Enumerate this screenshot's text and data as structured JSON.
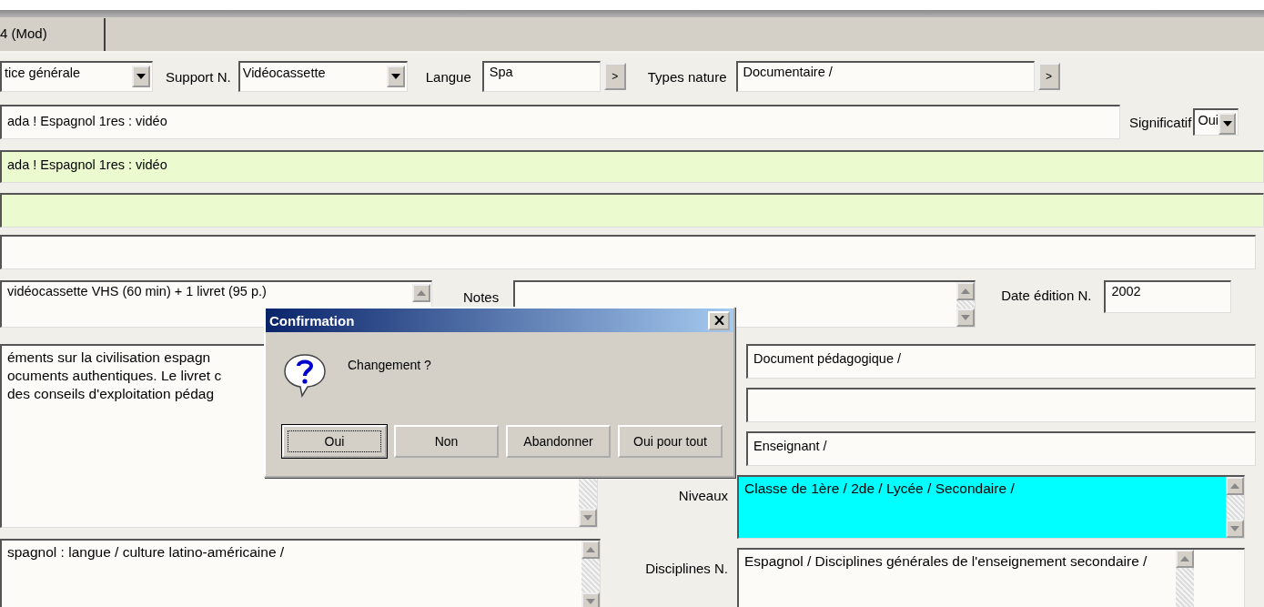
{
  "tab": {
    "label": "4 (Mod)",
    "selected": true
  },
  "notice_type": {
    "value": "tice générale"
  },
  "support": {
    "label": "Support N.",
    "value": "Vidéocassette"
  },
  "langue": {
    "label": "Langue",
    "value": "Spa",
    "button": ">"
  },
  "types_nature": {
    "label": "Types nature",
    "value": "Documentaire /",
    "button": ">"
  },
  "title_field": {
    "value": "ada ! Espagnol 1res : vidéo"
  },
  "significatif": {
    "label": "Significatif",
    "value": "Oui"
  },
  "green_title": {
    "value": "ada ! Espagnol 1res : vidéo"
  },
  "collation": {
    "value": "vidéocassette VHS (60 min) + 1 livret (95 p.)"
  },
  "notes": {
    "label": "Notes"
  },
  "date_edition": {
    "label": "Date édition N.",
    "value": "2002"
  },
  "description": {
    "lines": [
      "éments sur la civilisation espagn",
      "ocuments authentiques. Le livret c",
      "des conseils d'exploitation pédag"
    ]
  },
  "sujets": {
    "value": "spagnol : langue / culture latino-américaine /"
  },
  "genre": {
    "value": "Document pédagogique /"
  },
  "public": {
    "value": "Enseignant /"
  },
  "niveaux": {
    "label": "Niveaux",
    "value": "Classe de 1ère / 2de / Lycée / Secondaire /",
    "highlighted": true
  },
  "disciplines": {
    "label": "Disciplines N.",
    "value": "Espagnol / Disciplines générales de l'enseignement secondaire /"
  },
  "dialog": {
    "title": "Confirmation",
    "message": "Changement ?",
    "buttons": [
      {
        "label": "Oui",
        "focused": true
      },
      {
        "label": "Non",
        "focused": false
      },
      {
        "label": "Abandonner",
        "focused": false
      },
      {
        "label": "Oui pour tout",
        "focused": false
      }
    ]
  }
}
